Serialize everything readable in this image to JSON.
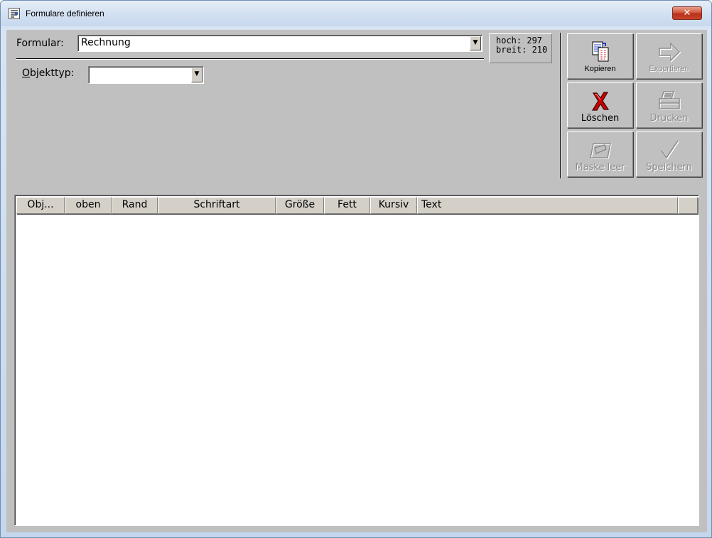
{
  "window": {
    "title": "Formulare definieren",
    "close_glyph": "✕"
  },
  "form": {
    "formular_label": "Formular:",
    "formular_value": "Rechnung",
    "objekttyp_label_accel": "O",
    "objekttyp_label_rest": "bjekttyp:",
    "objekttyp_value": ""
  },
  "size": {
    "hoch": "hoch: 297",
    "breit": "breit: 210"
  },
  "toolbar": {
    "kopieren": "Kopieren",
    "exportieren": "Exportieren",
    "loeschen": "Löschen",
    "drucken": "Drucken",
    "maske_leer": "Maske leer",
    "speichern": "Speichern"
  },
  "table": {
    "columns": [
      "Obj...",
      "oben",
      "Rand",
      "Schriftart",
      "Größe",
      "Fett",
      "Kursiv",
      "Text"
    ],
    "rows": []
  },
  "colors": {
    "face": "#c0c0c0",
    "delete_red": "#cc0000",
    "copy_blue": "#1f3fbf"
  }
}
